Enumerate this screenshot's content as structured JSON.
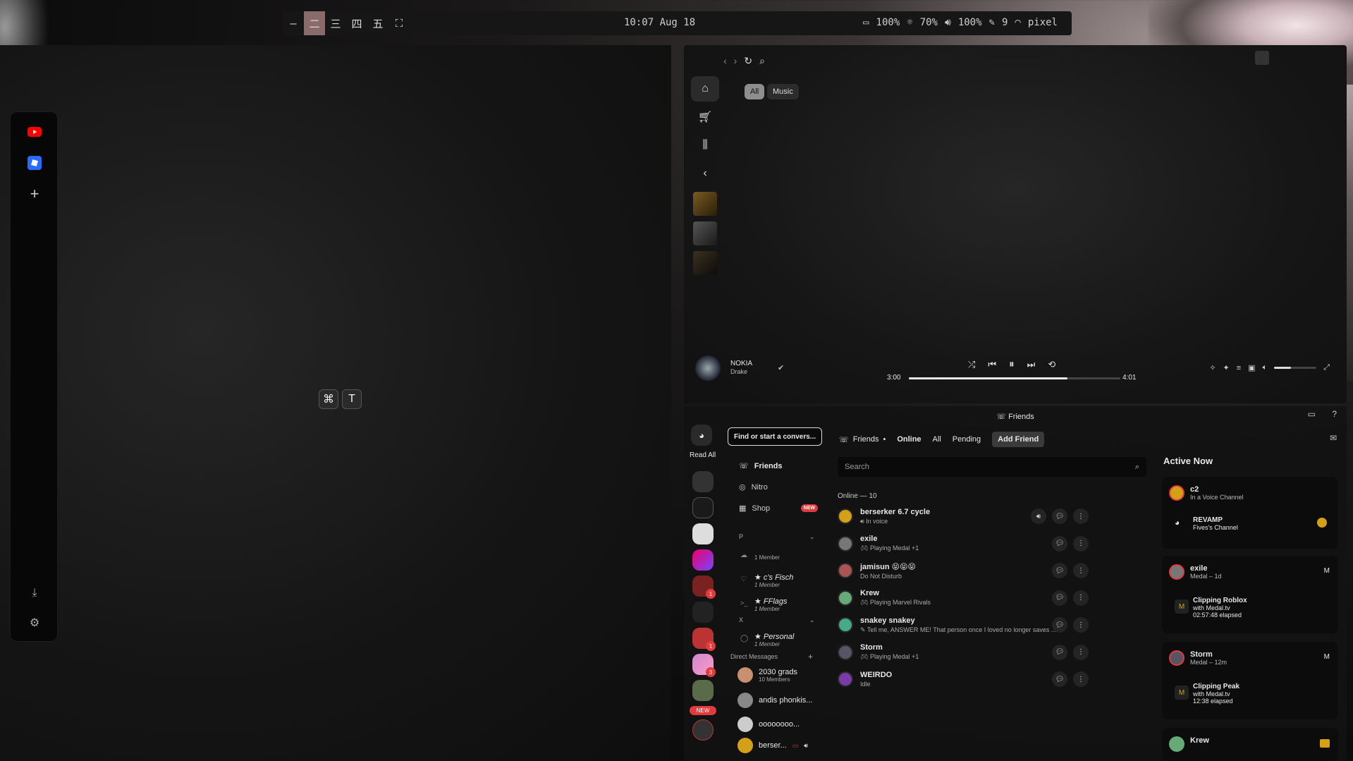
{
  "topbar": {
    "workspaces": [
      "—",
      "二",
      "三",
      "四",
      "五",
      "⛶"
    ],
    "clock": "10:07 Aug 18",
    "battery": "100%",
    "brightness": "70%",
    "volume": "100%",
    "edits": "9",
    "network": "pixel"
  },
  "terminal": {
    "shortcut_keys": [
      "⌘",
      "T"
    ]
  },
  "music": {
    "filters": [
      "All",
      "Music"
    ],
    "now_playing": {
      "title": "NOKIA",
      "artist": "Drake",
      "elapsed": "3:00",
      "total": "4:01",
      "progress": 0.75
    }
  },
  "discord": {
    "window_title": "Friends",
    "read_all": "Read All",
    "find_placeholder": "Find or start a convers...",
    "nav": {
      "friends": "Friends",
      "nitro": "Nitro",
      "shop": "Shop",
      "shop_badge": "NEW"
    },
    "groups": [
      {
        "header": "P"
      },
      {
        "name": "",
        "members": "1 Member"
      },
      {
        "name": "★ c's Fisch",
        "members": "1 Member"
      },
      {
        "name": "★ FFlags",
        "members": "1 Member"
      },
      {
        "header": "X"
      },
      {
        "name": "★ Personal",
        "members": "1 Member"
      }
    ],
    "direct_messages_label": "Direct Messages",
    "dms": [
      {
        "name": "2030 grads",
        "sub": "10 Members"
      },
      {
        "name": "andis phonkis...",
        "sub": ""
      },
      {
        "name": "оооооооо...",
        "sub": ""
      },
      {
        "name": "berser...",
        "sub": ""
      }
    ],
    "server_new_badge": "NEW",
    "server_badges": [
      "1",
      "1",
      "3"
    ],
    "tabs": {
      "friends": "Friends",
      "online": "Online",
      "all": "All",
      "pending": "Pending",
      "add_friend": "Add Friend"
    },
    "search_placeholder": "Search",
    "online_count": "Online — 10",
    "friends": [
      {
        "name": "berserker 6.7 cycle",
        "status": "In voice"
      },
      {
        "name": "exile",
        "status": "Playing Medal +1"
      },
      {
        "name": "jamisun 😝😝😝",
        "status": "Do Not Disturb"
      },
      {
        "name": "Krew",
        "status": "Playing Marvel Rivals"
      },
      {
        "name": "snakey snakey",
        "status": "Tell me, ANSWER ME! That person once I loved no longer saves ..."
      },
      {
        "name": "Storm",
        "status": "Playing Medal +1"
      },
      {
        "name": "WEIRDO",
        "status": "Idle"
      }
    ],
    "active_now": {
      "title": "Active Now",
      "cards": [
        {
          "name": "c2",
          "sub": "In a Voice Channel",
          "detail_title": "REVAMP",
          "detail_sub": "Fives's Channel",
          "detail_time": ""
        },
        {
          "name": "exile",
          "sub": "Medal – 1d",
          "detail_title": "Clipping Roblox",
          "detail_sub": "with Medal.tv",
          "detail_time": "02:57:48 elapsed"
        },
        {
          "name": "Storm",
          "sub": "Medal – 12m",
          "detail_title": "Clipping Peak",
          "detail_sub": "with Medal.tv",
          "detail_time": "12:38 elapsed"
        },
        {
          "name": "Krew",
          "sub": "",
          "detail_title": "",
          "detail_sub": "",
          "detail_time": ""
        }
      ]
    }
  },
  "colors": {
    "accent_red": "#e23b3b",
    "workspace_active": "#8a6a6a",
    "youtube": "#ff0000",
    "roblox": "#2a6bff"
  }
}
